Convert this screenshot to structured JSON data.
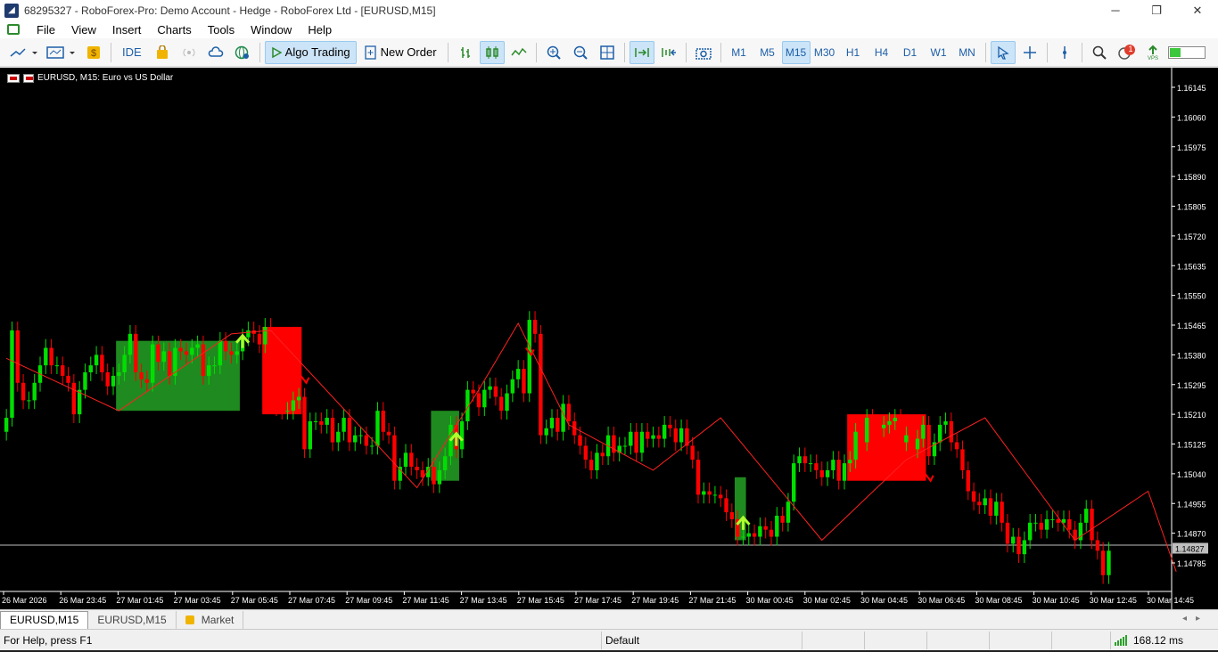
{
  "window": {
    "title": "68295327 - RoboForex-Pro: Demo Account - Hedge - RoboForex Ltd - [EURUSD,M15]",
    "minimize": "─",
    "restore": "❐",
    "close": "✕"
  },
  "menu": {
    "items": [
      {
        "label": "File"
      },
      {
        "label": "View"
      },
      {
        "label": "Insert"
      },
      {
        "label": "Charts"
      },
      {
        "label": "Tools"
      },
      {
        "label": "Window"
      },
      {
        "label": "Help"
      }
    ]
  },
  "toolbar": {
    "ide": "IDE",
    "algo_trading": "Algo Trading",
    "new_order": "New Order",
    "timeframes": [
      "M1",
      "M5",
      "M15",
      "M30",
      "H1",
      "H4",
      "D1",
      "W1",
      "MN"
    ],
    "active_timeframe": "M15",
    "notification_count": "1"
  },
  "chart": {
    "label": "EURUSD, M15:  Euro vs US Dollar",
    "background": "#000000",
    "bull_color": "#00e000",
    "bear_color": "#ff0000",
    "current_price": "1.14827",
    "price_ticks": [
      "1.16145",
      "1.16060",
      "1.15975",
      "1.15890",
      "1.15805",
      "1.15720",
      "1.15635",
      "1.15550",
      "1.15465",
      "1.15380",
      "1.15295",
      "1.15210",
      "1.15125",
      "1.15040",
      "1.14955",
      "1.14870",
      "1.14785"
    ],
    "time_ticks": [
      "26 Mar 2026",
      "26 Mar 23:45",
      "27 Mar 01:45",
      "27 Mar 03:45",
      "27 Mar 05:45",
      "27 Mar 07:45",
      "27 Mar 09:45",
      "27 Mar 11:45",
      "27 Mar 13:45",
      "27 Mar 15:45",
      "27 Mar 17:45",
      "27 Mar 19:45",
      "27 Mar 21:45",
      "30 Mar 00:45",
      "30 Mar 02:45",
      "30 Mar 04:45",
      "30 Mar 06:45",
      "30 Mar 08:45",
      "30 Mar 10:45",
      "30 Mar 12:45",
      "30 Mar 14:45"
    ]
  },
  "chart_data": {
    "type": "candlestick",
    "symbol": "EURUSD",
    "timeframe": "M15",
    "ylim": [
      1.1473,
      1.162
    ],
    "last_price": 1.14827,
    "candle_count": 208,
    "closes": [
      1.152,
      1.1545,
      1.153,
      1.1525,
      1.1525,
      1.153,
      1.1535,
      1.154,
      1.1535,
      1.1535,
      1.1532,
      1.153,
      1.1521,
      1.1528,
      1.1533,
      1.1535,
      1.1538,
      1.1533,
      1.1529,
      1.1532,
      1.1533,
      1.1538,
      1.1544,
      1.1533,
      1.1531,
      1.153,
      1.1541,
      1.1536,
      1.1539,
      1.1532,
      1.154,
      1.1539,
      1.1538,
      1.154,
      1.1541,
      1.1532,
      1.1535,
      1.1535,
      1.1542,
      1.1539,
      1.1538,
      1.1539,
      1.1543,
      1.1545,
      1.1544,
      1.1541,
      1.1546,
      1.1539,
      1.1523,
      1.1522,
      1.1522,
      1.1525,
      1.1526,
      1.1511,
      1.1519,
      1.1519,
      1.1518,
      1.152,
      1.1513,
      1.1516,
      1.152,
      1.1513,
      1.1515,
      1.1515,
      1.1512,
      1.1512,
      1.1522,
      1.1516,
      1.1515,
      1.1502,
      1.1506,
      1.151,
      1.1506,
      1.1505,
      1.1503,
      1.1506,
      1.1501,
      1.1505,
      1.1509,
      1.1518,
      1.1511,
      1.1519,
      1.1528,
      1.1527,
      1.1523,
      1.1528,
      1.1529,
      1.1526,
      1.1522,
      1.1527,
      1.1531,
      1.1534,
      1.1527,
      1.1548,
      1.1544,
      1.1515,
      1.1517,
      1.152,
      1.1516,
      1.1524,
      1.1519,
      1.1515,
      1.1512,
      1.1508,
      1.1505,
      1.151,
      1.1509,
      1.1515,
      1.151,
      1.1512,
      1.1512,
      1.1516,
      1.151,
      1.1516,
      1.1514,
      1.1515,
      1.1514,
      1.1518,
      1.1517,
      1.1513,
      1.1517,
      1.1512,
      1.1508,
      1.1498,
      1.1499,
      1.1498,
      1.1498,
      1.1497,
      1.1493,
      1.1491,
      1.1486,
      1.1486,
      1.1487,
      1.1486,
      1.1489,
      1.1488,
      1.1486,
      1.1492,
      1.149,
      1.1496,
      1.1507,
      1.1509,
      1.1507,
      1.1507,
      1.1505,
      1.1503,
      1.1505,
      1.1508,
      1.1502,
      1.1507,
      1.1508,
      1.1516,
      1.1513,
      1.152,
      1.1518,
      1.1517,
      1.1518,
      1.1519,
      1.152,
      1.1513,
      1.1515,
      1.1511,
      1.1514,
      1.1518,
      1.1509,
      1.1513,
      1.1518,
      1.1519,
      1.1513,
      1.1511,
      1.1505,
      1.1499,
      1.1496,
      1.1495,
      1.1497,
      1.1492,
      1.1496,
      1.149,
      1.1484,
      1.1486,
      1.1481,
      1.1485,
      1.149,
      1.149,
      1.1488,
      1.1491,
      1.1491,
      1.149,
      1.1491,
      1.1488,
      1.1485,
      1.149,
      1.1494,
      1.1485,
      1.1482,
      1.1475,
      1.1482
    ],
    "trend_line_points": [
      [
        0,
        1.1537
      ],
      [
        20,
        1.1522
      ],
      [
        40,
        1.1544
      ],
      [
        47,
        1.1545
      ],
      [
        73,
        1.15
      ],
      [
        84,
        1.1528
      ],
      [
        91,
        1.1547
      ],
      [
        100,
        1.1518
      ],
      [
        115,
        1.1505
      ],
      [
        127,
        1.152
      ],
      [
        145,
        1.1485
      ],
      [
        160,
        1.1508
      ],
      [
        174,
        1.152
      ],
      [
        190,
        1.1485
      ],
      [
        203,
        1.1499
      ],
      [
        208,
        1.1476
      ]
    ],
    "zones": [
      {
        "type": "demand",
        "color": "#1f8a1f",
        "from": 20,
        "to": 42,
        "top": 1.1542,
        "bottom": 1.1522
      },
      {
        "type": "supply",
        "color": "#ff0000",
        "from": 46,
        "to": 53,
        "top": 1.1546,
        "bottom": 1.1521
      },
      {
        "type": "demand",
        "color": "#1f8a1f",
        "from": 76,
        "to": 81,
        "top": 1.1522,
        "bottom": 1.1502
      },
      {
        "type": "supply",
        "color": "#ff0000",
        "from": 150,
        "to": 164,
        "top": 1.1521,
        "bottom": 1.1502
      },
      {
        "type": "demand",
        "color": "#1f8a1f",
        "from": 130,
        "to": 132,
        "top": 1.1503,
        "bottom": 1.1485
      }
    ],
    "arrows": [
      {
        "type": "up",
        "at": 42,
        "price": 1.1543,
        "color": "#adff2f"
      },
      {
        "type": "up",
        "at": 80,
        "price": 1.1515,
        "color": "#adff2f"
      },
      {
        "type": "up",
        "at": 131,
        "price": 1.1491,
        "color": "#adff2f"
      },
      {
        "type": "down",
        "at": 53,
        "price": 1.1531,
        "color": "#ff0000"
      },
      {
        "type": "down",
        "at": 93,
        "price": 1.1539,
        "color": "#ff0000"
      },
      {
        "type": "down",
        "at": 164,
        "price": 1.1503,
        "color": "#ff0000"
      }
    ]
  },
  "tabs": [
    {
      "label": "EURUSD,M15",
      "active": true
    },
    {
      "label": "EURUSD,M15",
      "active": false
    },
    {
      "label": "Market",
      "active": false
    }
  ],
  "status": {
    "help": "For Help, press F1",
    "profile": "Default",
    "ping": "168.12 ms"
  }
}
